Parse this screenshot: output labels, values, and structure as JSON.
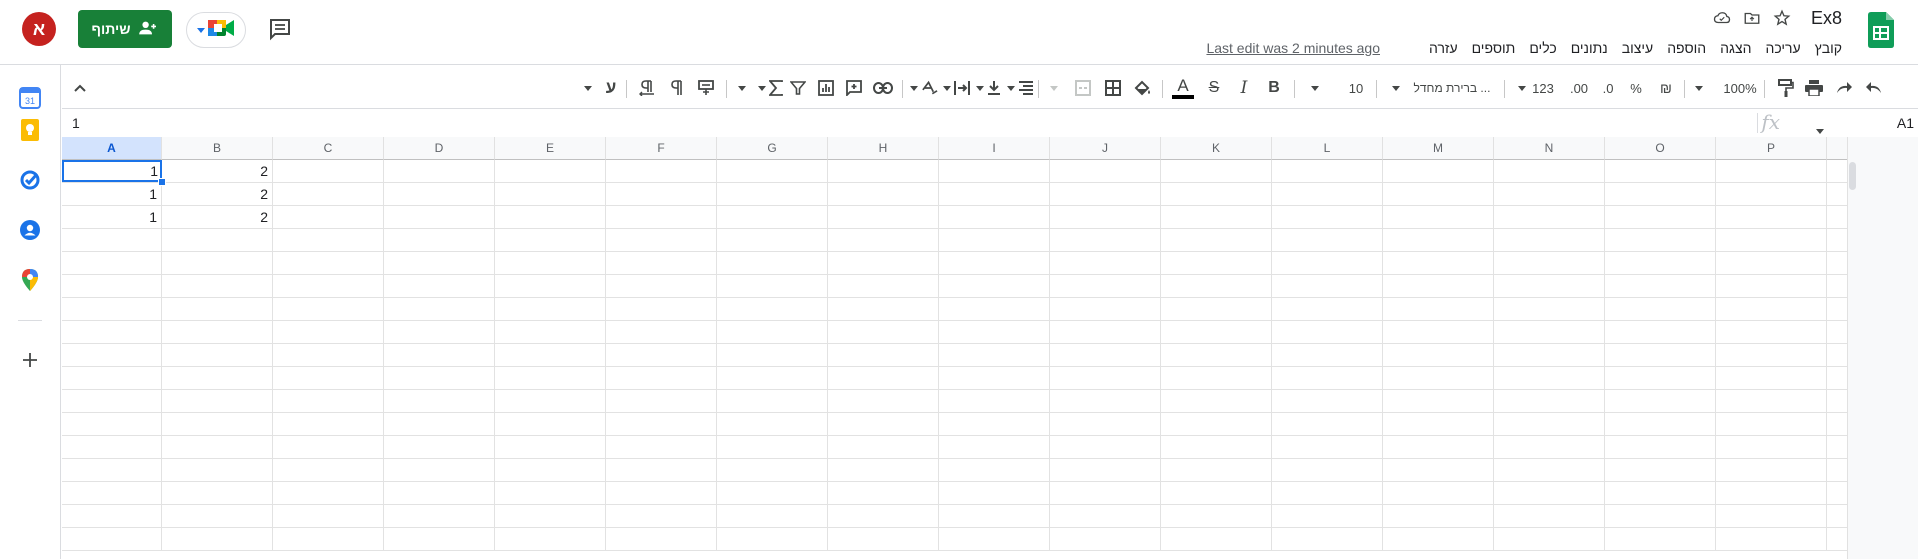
{
  "header": {
    "doc_title": "Ex8",
    "last_edit": "Last edit was 2 minutes ago",
    "menu": [
      "קובץ",
      "עריכה",
      "הצגה",
      "הוספה",
      "עיצוב",
      "נתונים",
      "כלים",
      "תוספים",
      "עזרה"
    ],
    "share_label": "שיתוף",
    "avatar_letter": "א",
    "icons": [
      "star-icon",
      "move-folder-icon",
      "cloud-status-icon"
    ]
  },
  "toolbar": {
    "zoom": "100%",
    "currency": "₪",
    "percent": "%",
    "decimal_decrease": ".0",
    "decimal_increase": ".00",
    "number_format": "123",
    "font": "ברירת מחדל ...",
    "font_size": "10",
    "bold": "B",
    "italic": "I",
    "strike": "S",
    "text_color": "A",
    "rtl_letter": "ע"
  },
  "formula_bar": {
    "name_box": "A1",
    "fx": "fx",
    "value": "1"
  },
  "grid": {
    "columns": [
      "A",
      "B",
      "C",
      "D",
      "E",
      "F",
      "G",
      "H",
      "I",
      "J",
      "K",
      "L",
      "M",
      "N",
      "O",
      "P"
    ],
    "active_cell": "A1",
    "rows": [
      [
        "1",
        "2"
      ],
      [
        "1",
        "2"
      ],
      [
        "1",
        "2"
      ]
    ]
  },
  "side_panel": {
    "icons": [
      "calendar-icon",
      "keep-icon",
      "tasks-icon",
      "contacts-icon",
      "maps-icon",
      "add-icon"
    ],
    "calendar_day": "31"
  },
  "colors": {
    "share_green": "#188038",
    "accent_blue": "#1a73e8",
    "avatar_red": "#c5221f"
  }
}
